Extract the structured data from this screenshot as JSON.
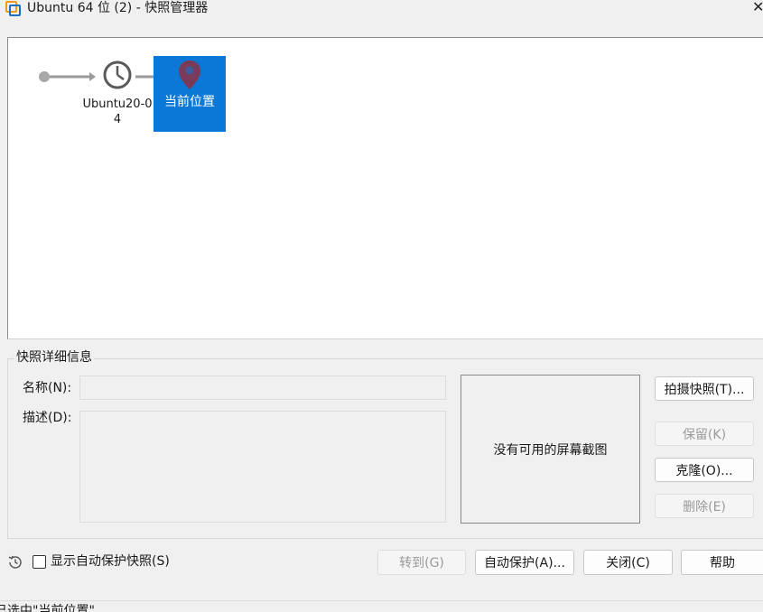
{
  "window": {
    "title": "Ubuntu 64 位 (2) - 快照管理器",
    "close_glyph": "✕"
  },
  "tree": {
    "snapshot_label": "Ubuntu20-04",
    "current_label": "当前位置"
  },
  "details": {
    "group_title": "快照详细信息",
    "name_label": "名称(N):",
    "name_value": "",
    "desc_label": "描述(D):",
    "desc_value": "",
    "no_screenshot": "没有可用的屏幕截图"
  },
  "actions": {
    "take_snapshot": "拍摄快照(T)...",
    "keep": "保留(K)",
    "clone": "克隆(O)...",
    "delete": "删除(E)"
  },
  "footer": {
    "show_autoprotect": "显示自动保护快照(S)",
    "goto": "转到(G)",
    "autoprotect": "自动保护(A)...",
    "close": "关闭(C)",
    "help": "帮助"
  },
  "status": {
    "text": "已选中\"当前位置\""
  },
  "colors": {
    "selection": "#0a78d7",
    "pin": "#7a3a5a"
  },
  "icons": {
    "app": "vmware-icon",
    "snapshot": "clock-icon",
    "current": "location-pin-icon",
    "history": "history-icon"
  }
}
